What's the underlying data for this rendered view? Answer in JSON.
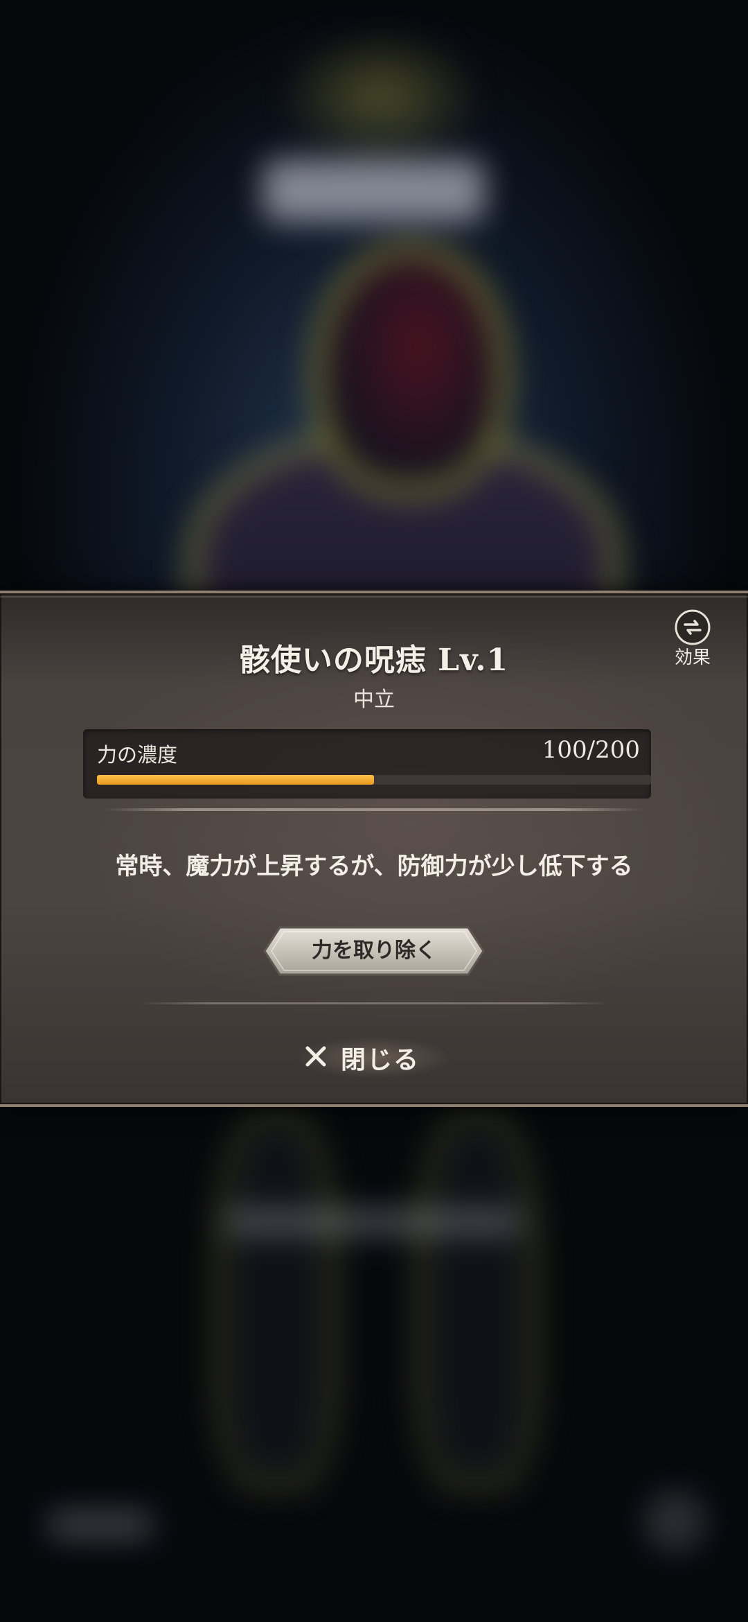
{
  "dialog": {
    "title": "骸使いの呪痣 Lv.1",
    "attribute": "中立",
    "effect_button": {
      "label": "効果",
      "icon": "swap-arrows-icon"
    },
    "gauge": {
      "label": "力の濃度",
      "value_text": "100/200",
      "fill_fraction": 0.5,
      "fill_color": "#f0a42e"
    },
    "description": "常時、魔力が上昇するが、防御力が少し低下する",
    "remove_button": {
      "label": "力を取り除く"
    },
    "close_button": {
      "label": "閉じる",
      "icon": "close-icon"
    }
  }
}
